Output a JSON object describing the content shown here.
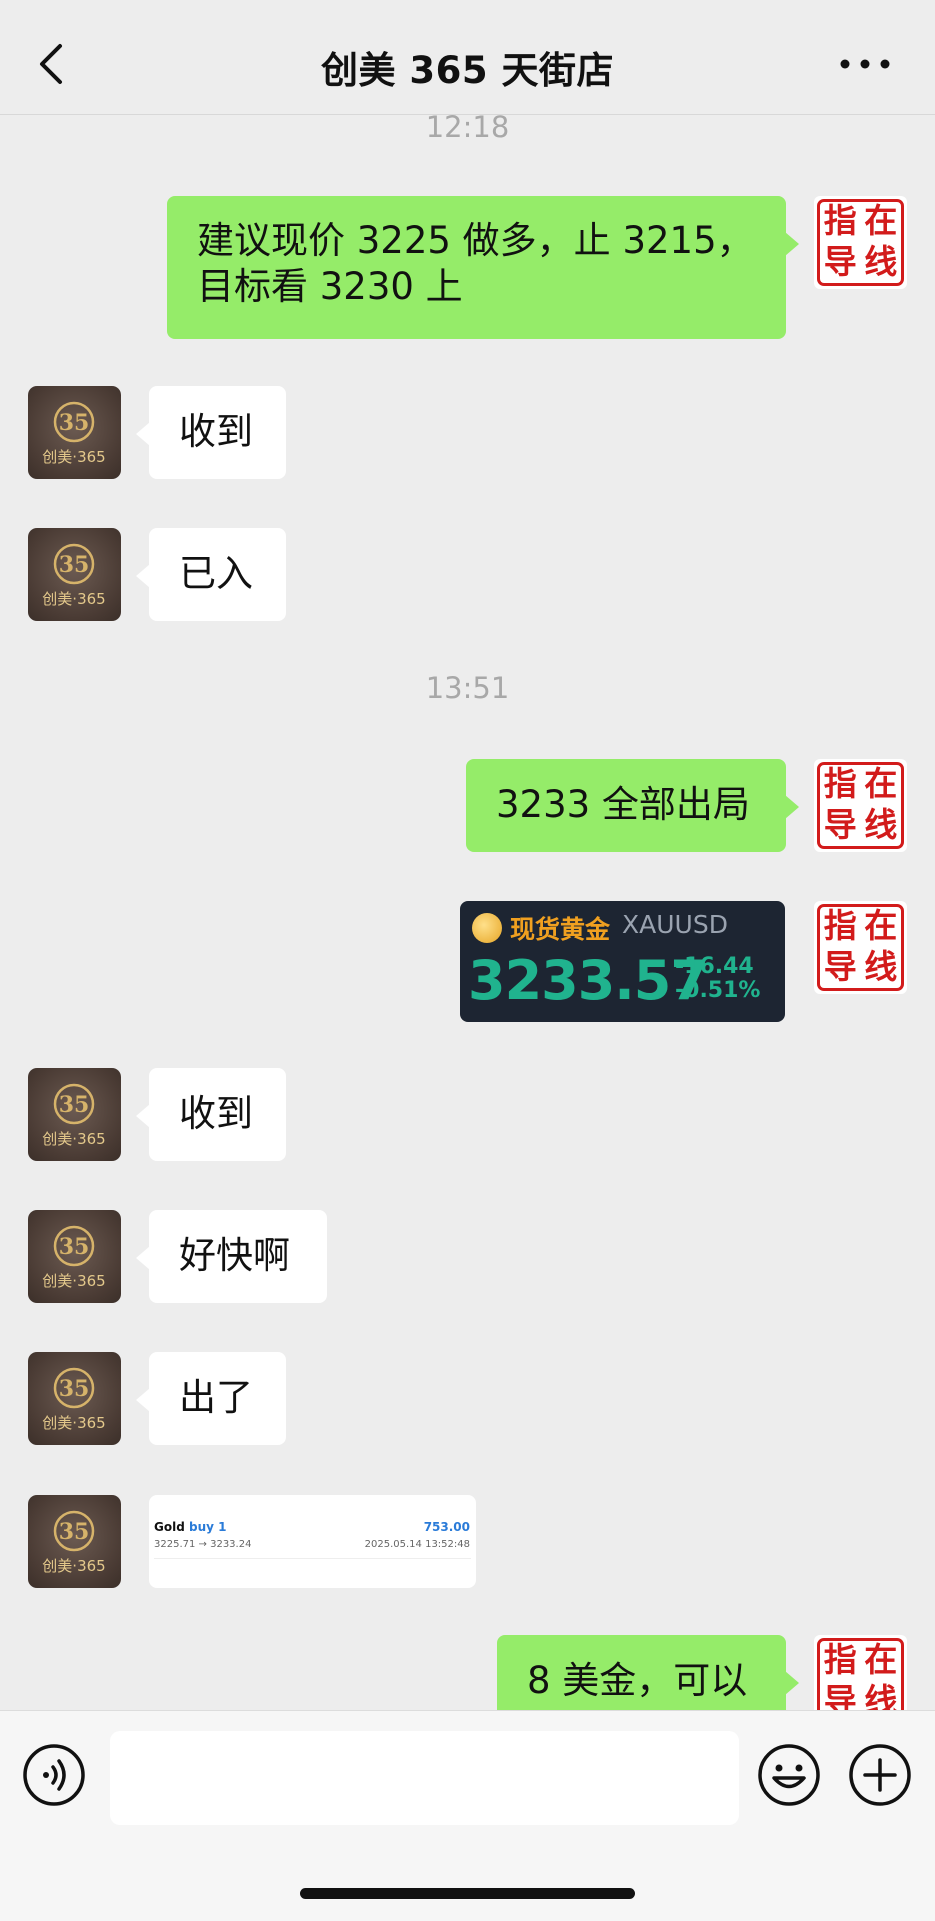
{
  "header": {
    "title": "创美 365 天街店"
  },
  "messages": {
    "ts1": "12:18",
    "m1_line1": "建议现价 3225 做多，止 3215，",
    "m1_line2": "目标看 3230 上",
    "m2": "收到",
    "m3": "已入",
    "ts2": "13:51",
    "m4": "3233 全部出局",
    "m5": "收到",
    "m6": "好快啊",
    "m7": "出了",
    "m8": "8 美金，可以"
  },
  "avatar_left": {
    "icon": "brand-logo-icon",
    "badge": "35",
    "text": "创美·365"
  },
  "avatar_right": {
    "icon": "stamp-avatar-icon",
    "chars": [
      "指",
      "在",
      "导",
      "线"
    ]
  },
  "gold_card": {
    "name": "现货黄金",
    "symbol": "XAUUSD",
    "price": "3233.57",
    "change": "-16.44",
    "change_pct": "-0.51%",
    "accent": "#20b38e"
  },
  "trade_card": {
    "instrument": "Gold",
    "side": "buy 1",
    "profit": "753.00",
    "prices": "3225.71 → 3233.24",
    "datetime": "2025.05.14 13:52:48"
  },
  "input_bar": {
    "placeholder": "",
    "voice_icon": "voice-icon",
    "emoji_icon": "emoji-icon",
    "plus_icon": "plus-icon"
  },
  "colors": {
    "outgoing": "#95ec69",
    "incoming": "#ffffff",
    "background": "#ededed",
    "stamp": "#d21b1b"
  }
}
